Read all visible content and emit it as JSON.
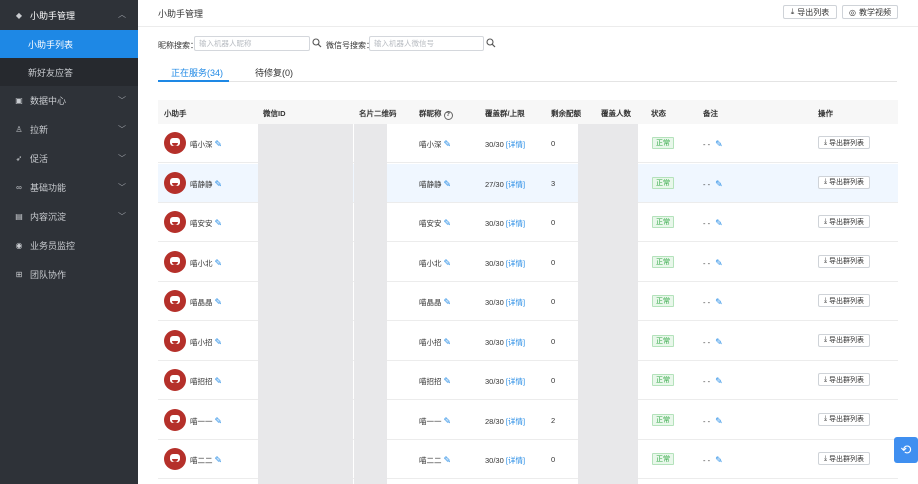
{
  "sidebar": {
    "top": {
      "label": "小助手管理",
      "icon": "diamond-icon"
    },
    "children": [
      {
        "label": "小助手列表",
        "active": true
      },
      {
        "label": "新好友应答",
        "active": false
      }
    ],
    "items": [
      {
        "label": "数据中心",
        "icon": "database-icon",
        "chevron": true
      },
      {
        "label": "拉新",
        "icon": "user-icon",
        "chevron": true
      },
      {
        "label": "促活",
        "icon": "rocket-icon",
        "chevron": true
      },
      {
        "label": "基础功能",
        "icon": "link-icon",
        "chevron": true
      },
      {
        "label": "内容沉淀",
        "icon": "document-icon",
        "chevron": true
      },
      {
        "label": "业务员监控",
        "icon": "eye-icon",
        "chevron": false
      },
      {
        "label": "团队协作",
        "icon": "team-icon",
        "chevron": false
      }
    ]
  },
  "header": {
    "title": "小助手管理",
    "export_label": "导出列表",
    "video_label": "教学视频"
  },
  "search": {
    "nickname_label": "昵称搜索：",
    "nickname_placeholder": "输入机器人昵称",
    "wechat_label": "微信号搜索：",
    "wechat_placeholder": "输入机器人微信号"
  },
  "tabs": [
    {
      "label": "正在服务(34)",
      "active": true
    },
    {
      "label": "待修复(0)",
      "active": false
    }
  ],
  "columns": [
    "小助手",
    "微信ID",
    "名片二维码",
    "群昵称",
    "覆盖群/上限",
    "剩余配额",
    "覆盖人数",
    "状态",
    "备注",
    "操作"
  ],
  "detail_label": "[详情]",
  "status_label": "正常",
  "remark_value": "- -",
  "row_action_label": "导出群列表",
  "rows": [
    {
      "name": "喵小深",
      "group_nick": "喵小深",
      "coverage": "30/30",
      "quota": "0"
    },
    {
      "name": "喵静静",
      "group_nick": "喵静静",
      "coverage": "27/30",
      "quota": "3"
    },
    {
      "name": "喵安安",
      "group_nick": "喵安安",
      "coverage": "30/30",
      "quota": "0"
    },
    {
      "name": "喵小北",
      "group_nick": "喵小北",
      "coverage": "30/30",
      "quota": "0"
    },
    {
      "name": "喵晶晶",
      "group_nick": "喵晶晶",
      "coverage": "30/30",
      "quota": "0"
    },
    {
      "name": "喵小招",
      "group_nick": "喵小招",
      "coverage": "30/30",
      "quota": "0"
    },
    {
      "name": "喵招招",
      "group_nick": "喵招招",
      "coverage": "30/30",
      "quota": "0"
    },
    {
      "name": "喵一一",
      "group_nick": "喵一一",
      "coverage": "28/30",
      "quota": "2"
    },
    {
      "name": "喵二二",
      "group_nick": "喵二二",
      "coverage": "30/30",
      "quota": "0"
    }
  ]
}
